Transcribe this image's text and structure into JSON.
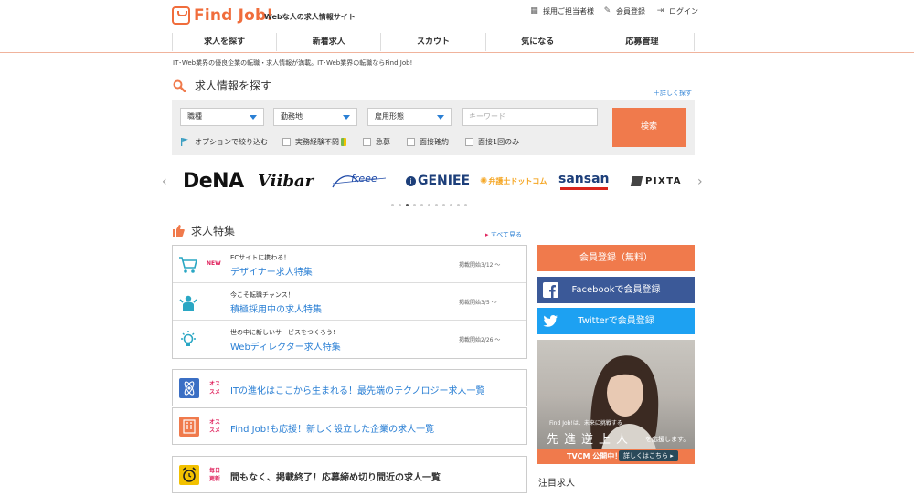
{
  "header": {
    "logo": "Find Job!",
    "tagline": "Webな人の求人情報サイト",
    "util": [
      {
        "label": "採用ご担当者様",
        "icon": "building-icon"
      },
      {
        "label": "会員登録",
        "icon": "pencil-icon"
      },
      {
        "label": "ログイン",
        "icon": "login-icon"
      }
    ],
    "nav": [
      "求人を探す",
      "新着求人",
      "スカウト",
      "気になる",
      "応募管理"
    ]
  },
  "intro": "IT･Web業界の優良企業の転職・求人情報が満載。IT･Web業界の転職ならFind Job!",
  "search": {
    "title": "求人情報を探す",
    "detail_link": "＋詳しく探す",
    "selects": [
      "職種",
      "勤務地",
      "雇用形態"
    ],
    "keyword_placeholder": "キーワード",
    "button": "検索",
    "options_label": "オプションで絞り込む",
    "options": [
      "実務経験不問",
      "急募",
      "面接確約",
      "面接1回のみ"
    ]
  },
  "brands": [
    "DeNA",
    "Viibar",
    "freee",
    "GENIEE",
    "弁護士ドットコム",
    "sansan",
    "PIXTA"
  ],
  "carousel": {
    "dots": 11,
    "active": 2
  },
  "features": {
    "title": "求人特集",
    "see_all": "すべて見る",
    "items": [
      {
        "badge": "NEW",
        "sub": "ECサイトに携わる！",
        "main": "デザイナー求人特集",
        "date": "掲載開始3/12 〜",
        "icon": "cart-icon"
      },
      {
        "badge": "",
        "sub": "今こそ転職チャンス！",
        "main": "積極採用中の求人特集",
        "date": "掲載開始3/5 〜",
        "icon": "people-icon"
      },
      {
        "badge": "",
        "sub": "世の中に新しいサービスをつくろう!",
        "main": "Webディレクター求人特集",
        "date": "掲載開始2/26 〜",
        "icon": "lightbulb-icon"
      }
    ]
  },
  "recommend": [
    {
      "tag1": "オス",
      "tag2": "スメ",
      "text": "ITの進化はここから生まれる！最先端のテクノロジー求人一覧",
      "icon": "atom-icon",
      "color": "#3b6fc4"
    },
    {
      "tag1": "オス",
      "tag2": "スメ",
      "text": "Find Job!も応援！新しく設立した企業の求人一覧",
      "icon": "building-grid-icon",
      "color": "#f07a4c"
    },
    {
      "tag1": "毎日",
      "tag2": "更新",
      "text": "間もなく、掲載終了！応募締め切り間近の求人一覧",
      "icon": "alarm-icon",
      "color": "#f2c100"
    }
  ],
  "side": {
    "register": "会員登録（無料）",
    "facebook": "Facebookで会員登録",
    "twitter": "Twitterで会員登録",
    "ad_small": "Find Job!は、未来に挑戦する",
    "ad_big": "先進逆上人",
    "ad_big2": "を応援します。",
    "ad_tvcm": "TVCM 公開中！",
    "ad_button": "詳しくはこちら ▸",
    "attention": "注目求人"
  },
  "colors": {
    "accent": "#f07a4c",
    "link": "#2a7fd4",
    "facebook": "#3b5998",
    "twitter": "#1da1f2"
  }
}
